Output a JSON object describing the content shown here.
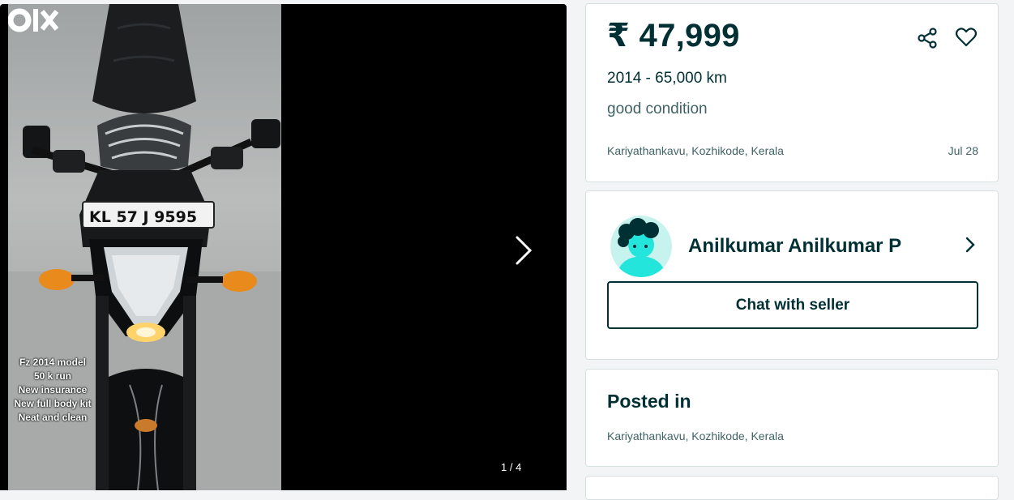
{
  "gallery": {
    "overlay_lines": [
      "Fz 2014 model",
      "50 k run",
      "New insurance",
      "New full body kit",
      "Neat and clean"
    ],
    "plate_text": "KL 57 J 9595",
    "counter": "1 / 4",
    "watermark": "OLX"
  },
  "listing": {
    "price": "₹ 47,999",
    "year_km": "2014 - 65,000 km",
    "condition": "good condition",
    "location": "Kariyathankavu, Kozhikode, Kerala",
    "date": "Jul 28"
  },
  "seller": {
    "name": "Anilkumar Anilkumar P",
    "chat_label": "Chat with seller"
  },
  "posted": {
    "title": "Posted in",
    "location": "Kariyathankavu, Kozhikode, Kerala"
  },
  "colors": {
    "primary": "#002f34",
    "secondary_text": "#406367",
    "avatar_bg": "#23e5db"
  }
}
